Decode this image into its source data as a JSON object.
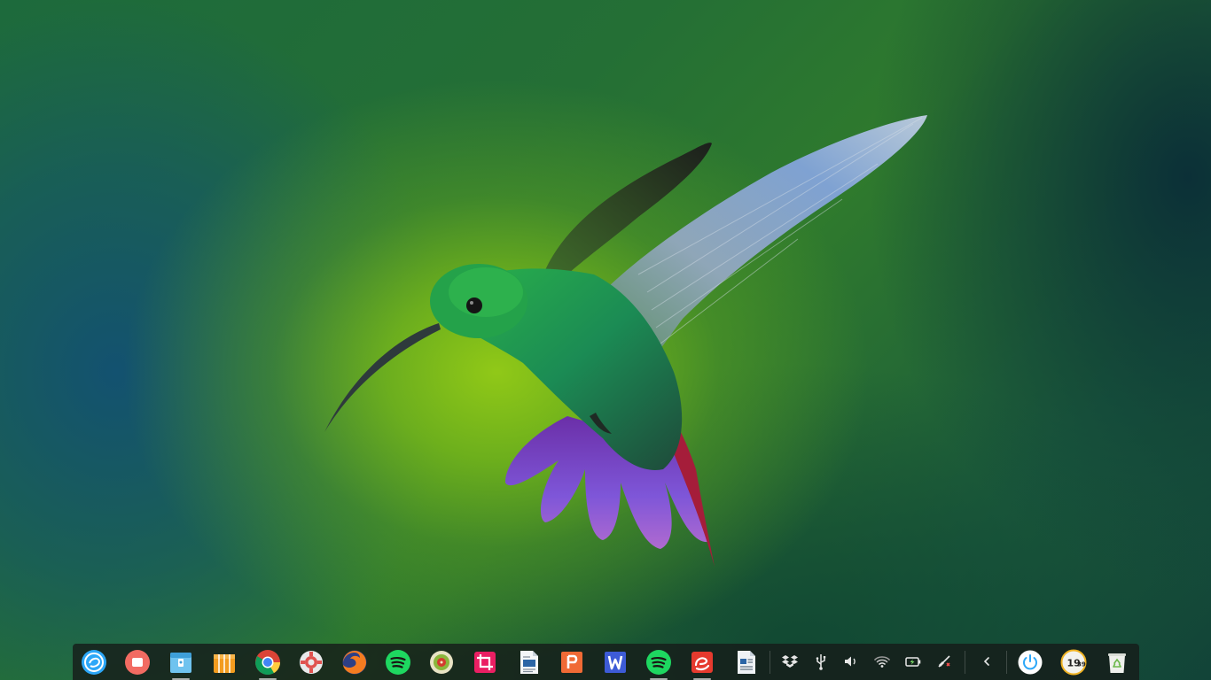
{
  "desktop": {
    "wallpaper": "hummingbird"
  },
  "dock": {
    "apps": [
      {
        "id": "launcher",
        "icon": "deepin-launcher-icon",
        "running": false
      },
      {
        "id": "multitasking",
        "icon": "multitasking-view-icon",
        "running": false
      },
      {
        "id": "file-manager",
        "icon": "file-manager-icon",
        "running": true
      },
      {
        "id": "app-store",
        "icon": "app-store-icon",
        "running": false
      },
      {
        "id": "chrome",
        "icon": "chrome-icon",
        "running": true
      },
      {
        "id": "settings",
        "icon": "control-center-icon",
        "running": false
      },
      {
        "id": "firefox",
        "icon": "firefox-icon",
        "running": false
      },
      {
        "id": "spotify",
        "icon": "spotify-icon",
        "running": false
      },
      {
        "id": "music-player",
        "icon": "music-player-icon",
        "running": false
      },
      {
        "id": "screenshot",
        "icon": "screenshot-crop-icon",
        "running": false
      },
      {
        "id": "writer",
        "icon": "document-writer-icon",
        "running": false
      },
      {
        "id": "wps-presentation",
        "icon": "wps-presentation-icon",
        "running": false
      },
      {
        "id": "wps-writer",
        "icon": "wps-writer-icon",
        "running": false
      },
      {
        "id": "spotify-2",
        "icon": "spotify-icon",
        "running": true
      },
      {
        "id": "eudic",
        "icon": "eudic-dictionary-icon",
        "running": true
      },
      {
        "id": "document-viewer",
        "icon": "document-viewer-icon",
        "running": false
      }
    ],
    "tray": [
      {
        "id": "dropbox",
        "icon": "dropbox-icon"
      },
      {
        "id": "usb",
        "icon": "usb-icon"
      },
      {
        "id": "volume",
        "icon": "volume-icon"
      },
      {
        "id": "wifi",
        "icon": "wifi-icon"
      },
      {
        "id": "battery",
        "icon": "battery-charging-icon"
      },
      {
        "id": "network",
        "icon": "network-disconnected-icon"
      },
      {
        "id": "expand",
        "icon": "chevron-left-icon"
      }
    ],
    "system": {
      "power_icon": "power-icon",
      "clock_hours": "19",
      "clock_minutes": "39",
      "trash_icon": "trash-icon"
    },
    "colors": {
      "dock_bg": "#161c1a",
      "accent": "#2ca7f8",
      "spotify": "#1ed760"
    }
  }
}
